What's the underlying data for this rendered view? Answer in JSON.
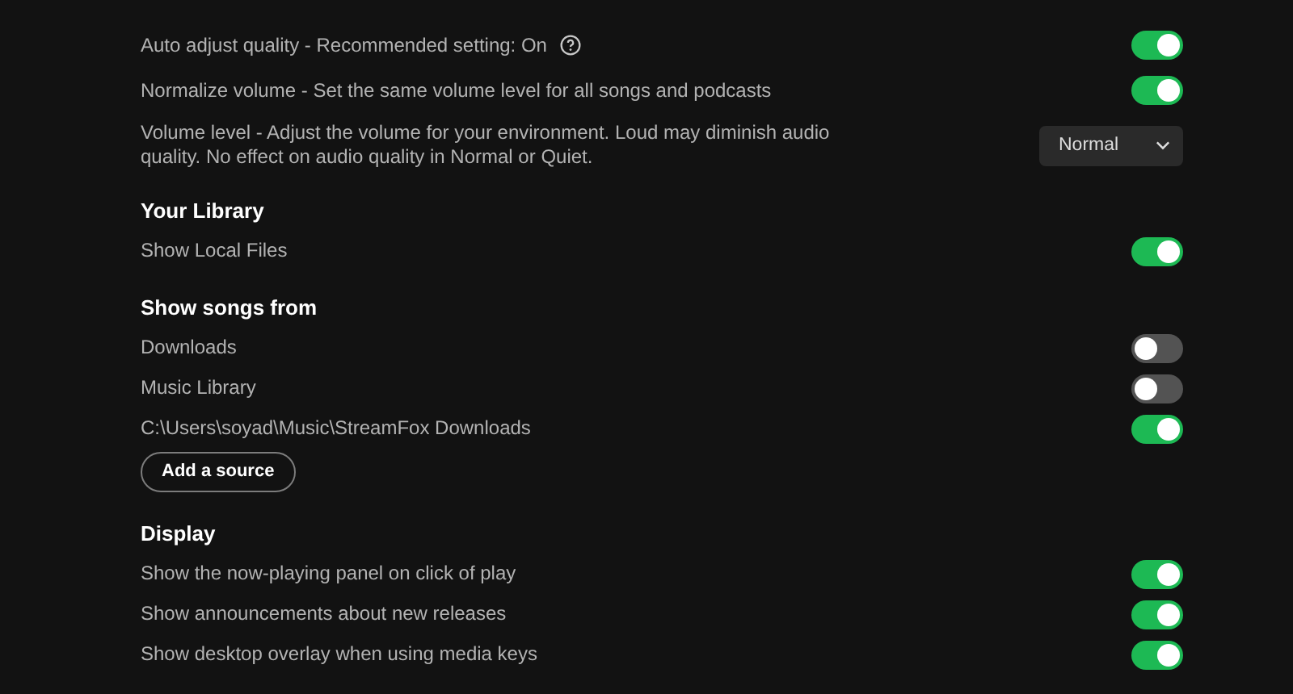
{
  "sections": [
    {
      "items": [
        {
          "kind": "toggle",
          "label": "Auto adjust quality - Recommended setting: On",
          "help": true,
          "on": true
        },
        {
          "kind": "toggle",
          "label": "Normalize volume - Set the same volume level for all songs and podcasts",
          "on": true
        },
        {
          "kind": "select",
          "label": "Volume level - Adjust the volume for your environment. Loud may diminish audio quality. No effect on audio quality in Normal or Quiet.",
          "value": "Normal"
        }
      ]
    },
    {
      "title": "Your Library",
      "items": [
        {
          "kind": "toggle",
          "label": "Show Local Files",
          "on": true
        }
      ]
    },
    {
      "title": "Show songs from",
      "items": [
        {
          "kind": "toggle",
          "label": "Downloads",
          "on": false
        },
        {
          "kind": "toggle",
          "label": "Music Library",
          "on": false
        },
        {
          "kind": "toggle",
          "label": "C:\\Users\\soyad\\Music\\StreamFox Downloads",
          "on": true
        },
        {
          "kind": "button",
          "label": "Add a source"
        }
      ]
    },
    {
      "title": "Display",
      "items": [
        {
          "kind": "toggle",
          "label": "Show the now-playing panel on click of play",
          "on": true
        },
        {
          "kind": "toggle",
          "label": "Show announcements about new releases",
          "on": true
        },
        {
          "kind": "toggle",
          "label": "Show desktop overlay when using media keys",
          "on": true
        }
      ]
    }
  ]
}
